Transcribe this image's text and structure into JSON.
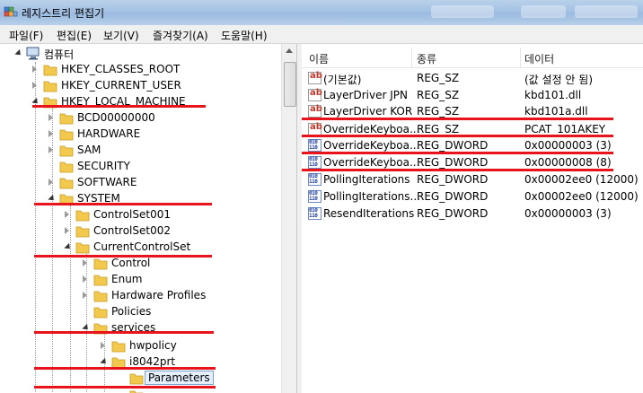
{
  "window": {
    "title": "레지스트리 편집기"
  },
  "menu": [
    "파일(F)",
    "편집(E)",
    "보기(V)",
    "즐겨찾기(A)",
    "도움말(H)"
  ],
  "tree": {
    "root": "컴퓨터",
    "nodes": [
      "HKEY_CLASSES_ROOT",
      "HKEY_CURRENT_USER",
      "HKEY_LOCAL_MACHINE",
      "BCD00000000",
      "HARDWARE",
      "SAM",
      "SECURITY",
      "SOFTWARE",
      "SYSTEM",
      "ControlSet001",
      "ControlSet002",
      "CurrentControlSet",
      "Control",
      "Enum",
      "Hardware Profiles",
      "Policies",
      "services",
      "hwpolicy",
      "i8042prt",
      "Parameters"
    ],
    "selected": "Parameters"
  },
  "list": {
    "columns": [
      "이름",
      "종류",
      "데이터"
    ],
    "rows": [
      {
        "name": "(기본값)",
        "type": "REG_SZ",
        "data": "(값 설정 안 됨)",
        "icon": "string-value-icon"
      },
      {
        "name": "LayerDriver JPN",
        "type": "REG_SZ",
        "data": "kbd101.dll",
        "icon": "string-value-icon"
      },
      {
        "name": "LayerDriver KOR",
        "type": "REG_SZ",
        "data": "kbd101a.dll",
        "icon": "string-value-icon"
      },
      {
        "name": "OverrideKeyboa...",
        "type": "REG_SZ",
        "data": "PCAT_101AKEY",
        "icon": "string-value-icon"
      },
      {
        "name": "OverrideKeyboa...",
        "type": "REG_DWORD",
        "data": "0x00000003 (3)",
        "icon": "binary-value-icon"
      },
      {
        "name": "OverrideKeyboa...",
        "type": "REG_DWORD",
        "data": "0x00000008 (8)",
        "icon": "binary-value-icon"
      },
      {
        "name": "PollingIterations",
        "type": "REG_DWORD",
        "data": "0x00002ee0 (12000)",
        "icon": "binary-value-icon"
      },
      {
        "name": "PollingIterations...",
        "type": "REG_DWORD",
        "data": "0x00002ee0 (12000)",
        "icon": "binary-value-icon"
      },
      {
        "name": "ResendIterations",
        "type": "REG_DWORD",
        "data": "0x00000003 (3)",
        "icon": "binary-value-icon"
      }
    ]
  },
  "colors": {
    "highlight_red": "#e8141c",
    "folder": "#f2c94c",
    "selection": "#e4effb"
  }
}
